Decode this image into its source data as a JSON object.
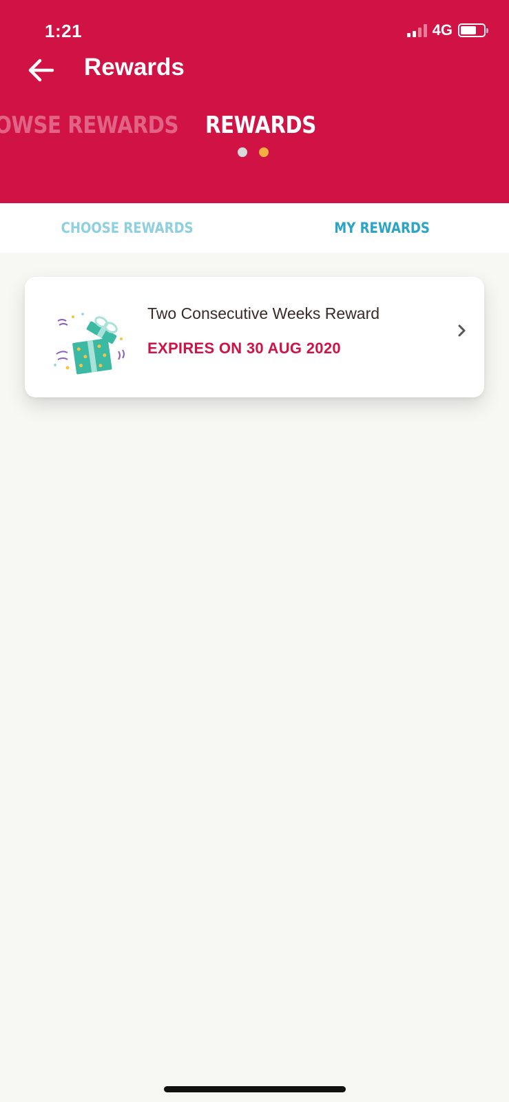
{
  "status_bar": {
    "time": "1:21",
    "network": "4G"
  },
  "header": {
    "title": "Rewards",
    "back_icon": "arrow-left-icon",
    "background_color": "#d11245",
    "carousel": {
      "prev_label": "ROWSE REWARDS",
      "current_label": "REWARDS",
      "dots": [
        {
          "color": "#d9d9d9"
        },
        {
          "color": "#f5b042"
        }
      ]
    }
  },
  "tabs": [
    {
      "label": "CHOOSE REWARDS",
      "active": false
    },
    {
      "label": "MY REWARDS",
      "active": true
    }
  ],
  "rewards": [
    {
      "name": "Two Consecutive Weeks Reward",
      "expiry": "EXPIRES ON 30 AUG 2020",
      "icon": "gift-box-icon",
      "chevron_icon": "chevron-right-icon"
    }
  ],
  "colors": {
    "accent": "#d11245",
    "tab_active": "#2ba4c6",
    "tab_inactive": "#8ecfe0",
    "background": "#f7f7f4"
  }
}
